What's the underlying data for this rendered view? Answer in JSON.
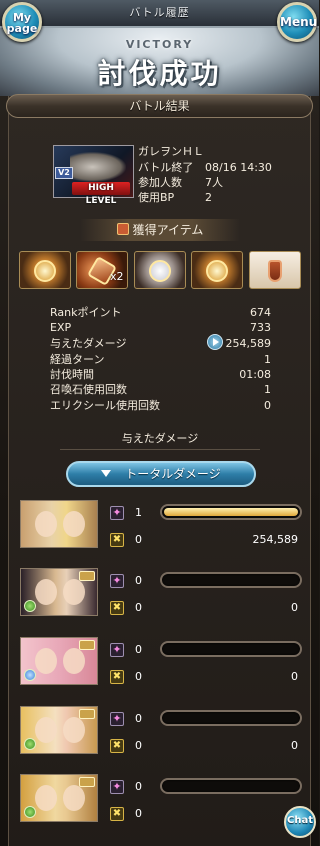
{
  "header": {
    "title": "バトル履歴",
    "mypage_label": "My page",
    "menu_label": "Menu",
    "victory": "VICTORY",
    "result_banner": "討伐成功"
  },
  "battle_result": {
    "section_title": "バトル結果",
    "boss_badge": "V2",
    "boss_level_label": "HIGH LEVEL",
    "boss_name": "ガレヲンＨＬ",
    "end_label": "バトル終了",
    "end_value": "08/16 14:30",
    "participants_label": "参加人数",
    "participants_value": "7人",
    "bp_label": "使用BP",
    "bp_value": "2"
  },
  "items": {
    "title": "獲得アイテム",
    "list": [
      {
        "icon": "gold-gem-icon",
        "count": ""
      },
      {
        "icon": "claw-material-icon",
        "count": "x2"
      },
      {
        "icon": "silver-material-icon",
        "count": ""
      },
      {
        "icon": "gold-ring-icon",
        "count": ""
      },
      {
        "icon": "potion-icon",
        "count": ""
      }
    ]
  },
  "stats": {
    "rank_label": "Rankポイント",
    "rank_value": "674",
    "exp_label": "EXP",
    "exp_value": "733",
    "damage_label": "与えたダメージ",
    "damage_value": "254,589",
    "turns_label": "経過ターン",
    "turns_value": "1",
    "time_label": "討伐時間",
    "time_value": "01:08",
    "summons_label": "召喚石使用回数",
    "summons_value": "1",
    "elixir_label": "エリクシール使用回数",
    "elixir_value": "0"
  },
  "damage_section": {
    "title": "与えたダメージ",
    "dropdown_label": "トータルダメージ",
    "rows": [
      {
        "skill_count": "1",
        "ca_count": "0",
        "damage": "254,589",
        "fill": 1.0
      },
      {
        "skill_count": "0",
        "ca_count": "0",
        "damage": "0",
        "fill": 0
      },
      {
        "skill_count": "0",
        "ca_count": "0",
        "damage": "0",
        "fill": 0
      },
      {
        "skill_count": "0",
        "ca_count": "0",
        "damage": "0",
        "fill": 0
      },
      {
        "skill_count": "0",
        "ca_count": "0",
        "damage": "",
        "fill": 0
      }
    ]
  },
  "chat_label": "Chat"
}
